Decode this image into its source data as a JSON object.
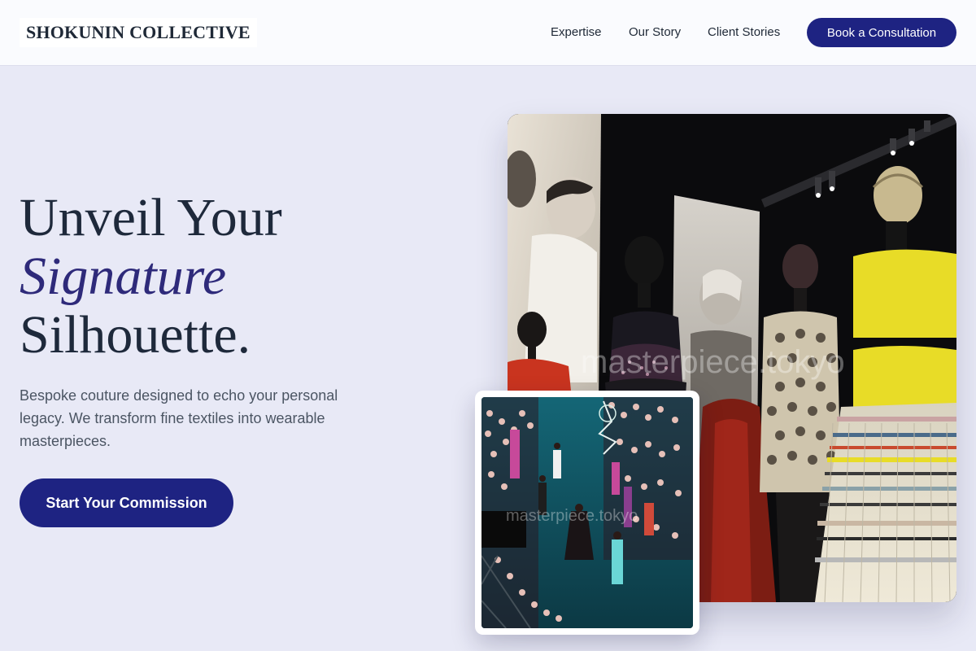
{
  "header": {
    "logo": "SHOKUNIN COLLECTIVE",
    "nav": [
      {
        "label": "Expertise"
      },
      {
        "label": "Our Story"
      },
      {
        "label": "Client Stories"
      }
    ],
    "cta_label": "Book a Consultation"
  },
  "hero": {
    "title_line1": "Unveil Your",
    "title_accent": "Signature",
    "title_line3": "Silhouette.",
    "description": "Bespoke couture designed to echo your personal legacy. We transform fine textiles into wearable masterpieces.",
    "cta_label": "Start Your Commission"
  },
  "images": {
    "main_watermark": "masterpiece.tokyo",
    "inset_watermark": "masterpiece.tokyo"
  },
  "colors": {
    "background": "#e8e9f6",
    "accent": "#1e2382",
    "accent_text": "#2e2a7a",
    "text": "#1e293b"
  }
}
